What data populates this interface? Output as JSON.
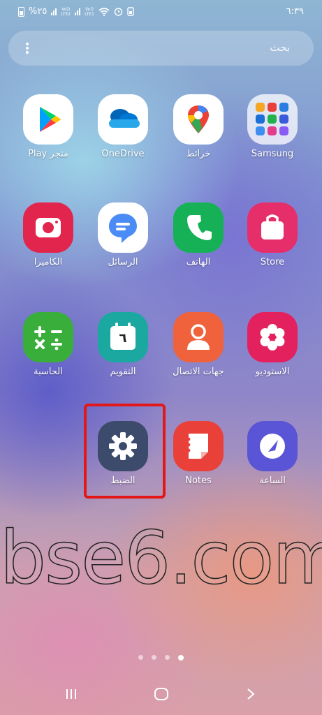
{
  "status_bar": {
    "battery_text": "%٢٥",
    "sim2_label": "LTE2",
    "sim1_label": "LTE1",
    "volte_label": "Vo))",
    "time": "٦:٣٩"
  },
  "search": {
    "placeholder": "بحث"
  },
  "apps": [
    {
      "label": "Play متجر",
      "icon": "play-store-icon"
    },
    {
      "label": "OneDrive",
      "icon": "onedrive-icon"
    },
    {
      "label": "خرائط",
      "icon": "maps-icon"
    },
    {
      "label": "Samsung",
      "icon": "samsung-folder-icon"
    },
    {
      "label": "الكاميرا",
      "icon": "camera-icon"
    },
    {
      "label": "الرسائل",
      "icon": "messages-icon"
    },
    {
      "label": "الهاتف",
      "icon": "phone-icon"
    },
    {
      "label": "Store",
      "icon": "store-icon"
    },
    {
      "label": "الحاسبة",
      "icon": "calculator-icon"
    },
    {
      "label": "التقويم",
      "icon": "calendar-icon"
    },
    {
      "label": "جهات الاتصال",
      "icon": "contacts-icon"
    },
    {
      "label": "الاستوديو",
      "icon": "gallery-icon"
    },
    {
      "label": "الضبط",
      "icon": "settings-icon"
    },
    {
      "label": "Notes",
      "icon": "notes-icon"
    },
    {
      "label": "الساعة",
      "icon": "clock-icon"
    }
  ],
  "calendar_day": "٦",
  "watermark": "bse6.com",
  "pager": {
    "pages": 4,
    "current": 4
  },
  "colors": {
    "highlight": "#e31717"
  }
}
